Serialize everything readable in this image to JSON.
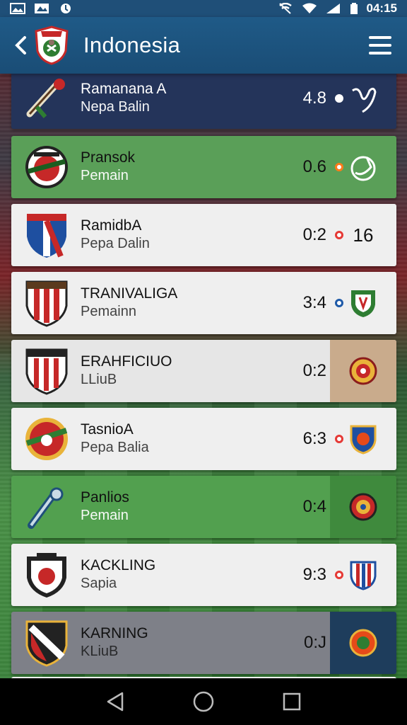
{
  "status_bar": {
    "time": "04:15",
    "left_icons": [
      "image-icon",
      "photo-icon",
      "notification-icon"
    ],
    "right_icons": [
      "wifi-off-icon",
      "wifi-icon",
      "signal-icon",
      "battery-icon"
    ]
  },
  "header": {
    "title": "Indonesia",
    "back_icon": "chevron-left-icon",
    "menu_icon": "hamburger-menu-icon",
    "background_color": "#1f5a87"
  },
  "rows": [
    {
      "name": "Ramanana A",
      "sub": "Nepa Balin",
      "score": "4.8",
      "dot_color": "#ffffff",
      "end_text": "",
      "end_icon": "leaf-icon"
    },
    {
      "name": "Pransok",
      "sub": "Pemain",
      "score": "0.6",
      "dot_color": "#ff7a1a",
      "end_text": "",
      "end_icon": "hand-icon"
    },
    {
      "name": "RamidbA",
      "sub": "Pepa Dalin",
      "score": "0:2",
      "dot_color": "#e53935",
      "end_text": "16",
      "end_icon": ""
    },
    {
      "name": "TRANIVALIGA",
      "sub": "Pemainn",
      "score": "3:4",
      "dot_color": "#1e5aa8",
      "end_text": "",
      "end_icon": "shield-icon"
    },
    {
      "name": "ERAHFICIUO",
      "sub": "LLiuB",
      "score": "0:2",
      "dot_color": "#e53935",
      "end_text": "",
      "end_icon": "round-crest-icon"
    },
    {
      "name": "TasnioA",
      "sub": "Pepa Balia",
      "score": "6:3",
      "dot_color": "#e53935",
      "end_text": "",
      "end_icon": "shield-icon"
    },
    {
      "name": "Panlios",
      "sub": "Pemain",
      "score": "0:4",
      "dot_color": "#ff7a1a",
      "end_text": "",
      "end_icon": "round-crest-icon"
    },
    {
      "name": "KACKLING",
      "sub": "Sapia",
      "score": "9:3",
      "dot_color": "#e53935",
      "end_text": "",
      "end_icon": "striped-shield-icon"
    },
    {
      "name": "KARNING",
      "sub": "KLiuB",
      "score": "0:J",
      "dot_color": "#ffffff",
      "end_text": "",
      "end_icon": "round-crest-icon"
    }
  ],
  "nav_bar": {
    "buttons": [
      "back-triangle-icon",
      "home-circle-icon",
      "recents-square-icon"
    ]
  }
}
